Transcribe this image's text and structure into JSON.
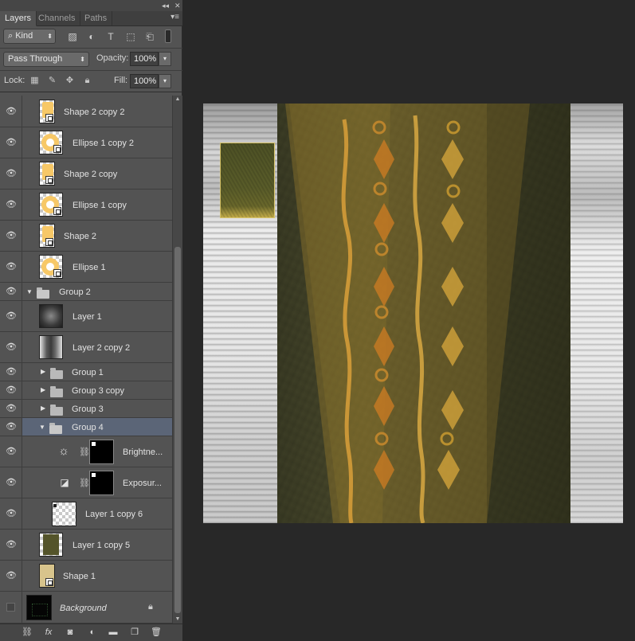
{
  "panel": {
    "top_controls": {
      "collapse": "◂◂",
      "close": "✕"
    },
    "tabs": [
      {
        "label": "Layers",
        "active": true
      },
      {
        "label": "Channels",
        "active": false
      },
      {
        "label": "Paths",
        "active": false
      }
    ],
    "tab_menu": "▾≡",
    "filter": {
      "kind_label": "Kind",
      "kind_icon": "search-icon",
      "icons": [
        "image-filter-icon",
        "adjustment-filter-icon",
        "type-filter-icon",
        "shape-filter-icon",
        "smart-object-filter-icon"
      ]
    },
    "blend_mode": "Pass Through",
    "opacity_label": "Opacity:",
    "opacity_value": "100%",
    "lock_label": "Lock:",
    "lock_icons": [
      "lock-transparent-icon",
      "lock-image-icon",
      "lock-position-icon",
      "lock-all-icon"
    ],
    "fill_label": "Fill:",
    "fill_value": "100%"
  },
  "layers": [
    {
      "name": "Shape 2 copy 2",
      "type": "shape",
      "indent": 1,
      "visible": true
    },
    {
      "name": "Ellipse 1 copy 2",
      "type": "ellipse",
      "indent": 1,
      "visible": true
    },
    {
      "name": "Shape 2 copy",
      "type": "shape",
      "indent": 1,
      "visible": true
    },
    {
      "name": "Ellipse 1 copy",
      "type": "ellipse",
      "indent": 1,
      "visible": true
    },
    {
      "name": "Shape 2",
      "type": "shape",
      "indent": 1,
      "visible": true
    },
    {
      "name": "Ellipse 1",
      "type": "ellipse",
      "indent": 1,
      "visible": true
    },
    {
      "name": "Group 2",
      "type": "group",
      "expanded": true,
      "indent": 0,
      "visible": true
    },
    {
      "name": "Layer 1",
      "type": "raster",
      "indent": 1,
      "visible": true
    },
    {
      "name": "Layer 2 copy 2",
      "type": "raster",
      "indent": 1,
      "visible": true
    },
    {
      "name": "Group 1",
      "type": "group",
      "expanded": false,
      "indent": 1,
      "visible": true
    },
    {
      "name": "Group 3 copy",
      "type": "group",
      "expanded": false,
      "indent": 1,
      "visible": true
    },
    {
      "name": "Group 3",
      "type": "group",
      "expanded": false,
      "indent": 1,
      "visible": true
    },
    {
      "name": "Group 4",
      "type": "group",
      "expanded": true,
      "indent": 1,
      "visible": true,
      "selected": true
    },
    {
      "name": "Brightne...",
      "type": "adjustment",
      "icon": "brightness-icon",
      "indent": 2,
      "visible": true
    },
    {
      "name": "Exposur...",
      "type": "adjustment",
      "icon": "exposure-icon",
      "indent": 2,
      "visible": true
    },
    {
      "name": "Layer 1 copy 6",
      "type": "raster-empty",
      "indent": 2,
      "visible": true
    },
    {
      "name": "Layer 1 copy 5",
      "type": "raster-green",
      "indent": 1,
      "visible": true
    },
    {
      "name": "Shape 1",
      "type": "shape-tan",
      "indent": 1,
      "visible": true
    },
    {
      "name": "Background",
      "type": "background",
      "indent": 0,
      "visible": false,
      "locked": true
    }
  ],
  "bottom_icons": [
    "link-layers-icon",
    "fx-icon",
    "add-mask-icon",
    "new-adjustment-icon",
    "new-group-icon",
    "new-layer-icon",
    "trash-icon"
  ],
  "bottom_labels": {
    "fx": "fx"
  },
  "colors": {
    "panel_bg": "#535353",
    "selected_row": "#5b6577",
    "shape_fill": "#f7c867",
    "motif_gold": "#d9a83c",
    "motif_orange": "#c97b23"
  }
}
